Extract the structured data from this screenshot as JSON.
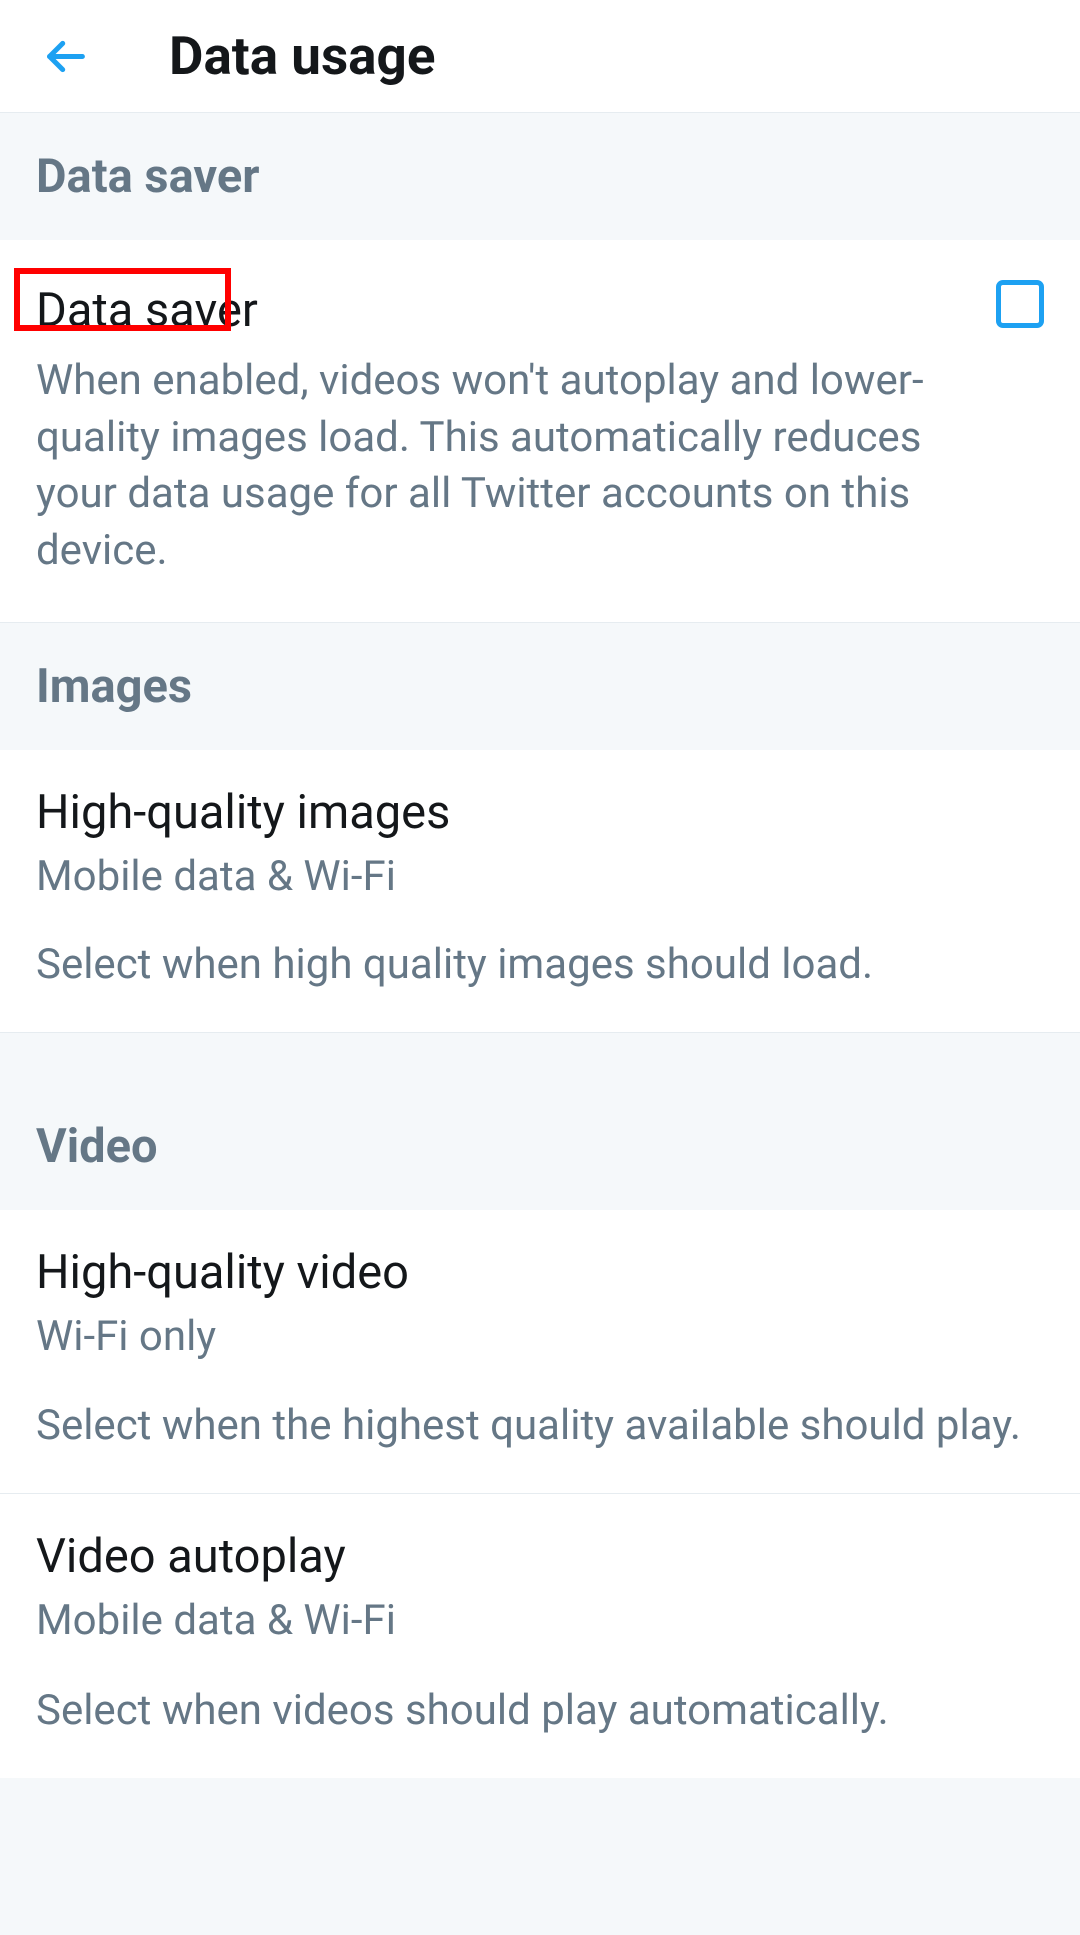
{
  "header": {
    "title": "Data usage"
  },
  "sections": {
    "dataSaver": {
      "heading": "Data saver",
      "item": {
        "title": "Data saver",
        "description": "When enabled, videos won't autoplay and lower-quality images load. This automatically reduces your data usage for all Twitter accounts on this device."
      }
    },
    "images": {
      "heading": "Images",
      "item": {
        "title": "High-quality images",
        "subtitle": "Mobile data & Wi-Fi",
        "description": "Select when high quality images should load."
      }
    },
    "video": {
      "heading": "Video",
      "items": [
        {
          "title": "High-quality video",
          "subtitle": "Wi-Fi only",
          "description": "Select when the highest quality available should play."
        },
        {
          "title": "Video autoplay",
          "subtitle": "Mobile data & Wi-Fi",
          "description": "Select when videos should play automatically."
        }
      ]
    }
  }
}
